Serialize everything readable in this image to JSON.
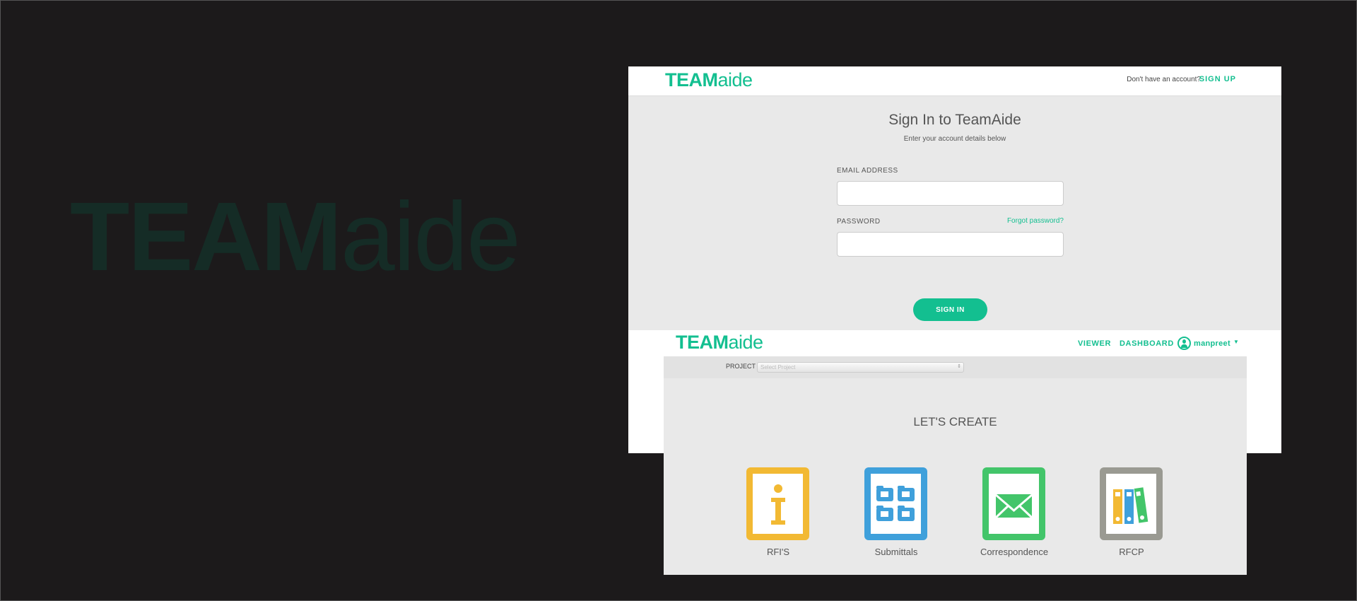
{
  "watermark": {
    "bold": "TEAM",
    "light": "aide"
  },
  "signin": {
    "logo": {
      "bold": "TEAM",
      "light": "aide"
    },
    "no_account": "Don't have an account?",
    "sign_up": "SIGN UP",
    "title": "Sign In to TeamAide",
    "subtitle": "Enter your account details below",
    "email_label": "EMAIL ADDRESS",
    "email_value": "",
    "password_label": "PASSWORD",
    "password_value": "",
    "forgot": "Forgot password?",
    "button": "SIGN IN"
  },
  "dashboard": {
    "logo": {
      "bold": "TEAM",
      "light": "aide"
    },
    "nav": [
      "VIEWER",
      "DASHBOARD"
    ],
    "user": "manpreet",
    "project_label": "PROJECT",
    "project_placeholder": "Select Project",
    "heading": "LET'S CREATE",
    "cards": [
      {
        "label": "RFI'S",
        "color": "#f2b933",
        "icon": "info-icon"
      },
      {
        "label": "Submittals",
        "color": "#3fa0db",
        "icon": "folders-icon"
      },
      {
        "label": "Correspondence",
        "color": "#43c56a",
        "icon": "envelope-icon"
      },
      {
        "label": "RFCP",
        "color": "#9a9a92",
        "icon": "binders-icon"
      }
    ]
  }
}
